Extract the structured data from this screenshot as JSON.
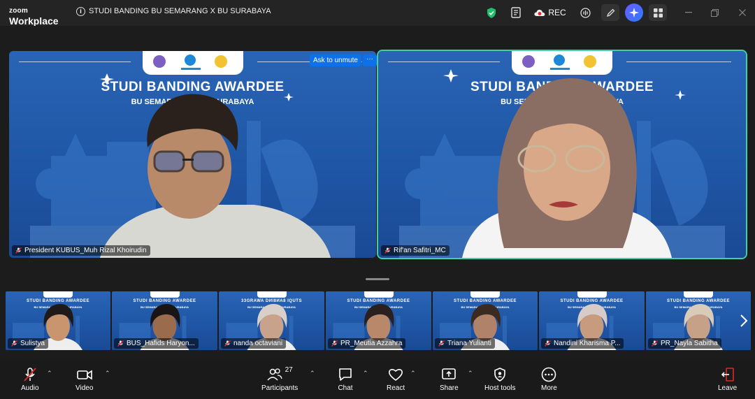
{
  "app": {
    "logo_top": "zoom",
    "logo_bottom": "Workplace"
  },
  "meeting": {
    "title": "STUDI BANDING BU SEMARANG X BU SURABAYA"
  },
  "titlebar": {
    "rec_label": "REC"
  },
  "banner": {
    "title": "STUDI BANDING AWARDEE",
    "subtitle": "BU SEMARANG X BU SURABAYA",
    "small_title": "STUDI BANDING AWARDEE",
    "small_subtitle_left": "BU SEMARANG",
    "small_subtitle_right": "BU SURABAYA",
    "mirrored_title": "33GRAWA DИI8ИA8 IQUTS"
  },
  "main_tiles": [
    {
      "name": "President KUBUS_Muh Rizal Khoirudin",
      "muted": true
    },
    {
      "name": "Rif'an Safitri_MC",
      "muted": true
    }
  ],
  "overlay": {
    "ask_unmute": "Ask to unmute",
    "more": "···"
  },
  "strip_tiles": [
    {
      "name": "Sulistya"
    },
    {
      "name": "BUS_Hafids Haryon..."
    },
    {
      "name": "nanda octaviani"
    },
    {
      "name": "PR_Meutia Azzahra"
    },
    {
      "name": "Triana Yulianti"
    },
    {
      "name": "Nandini Kharisma P..."
    },
    {
      "name": "PR_Nayla Sabitha"
    }
  ],
  "toolbar": {
    "audio": "Audio",
    "video": "Video",
    "participants": "Participants",
    "participants_count": "27",
    "chat": "Chat",
    "react": "React",
    "share": "Share",
    "host_tools": "Host tools",
    "more": "More",
    "leave": "Leave"
  },
  "colors": {
    "accent": "#0e71eb",
    "active_speaker": "#3fd0a6",
    "rec_red": "#e02828",
    "shield_green": "#1fbf6b"
  }
}
